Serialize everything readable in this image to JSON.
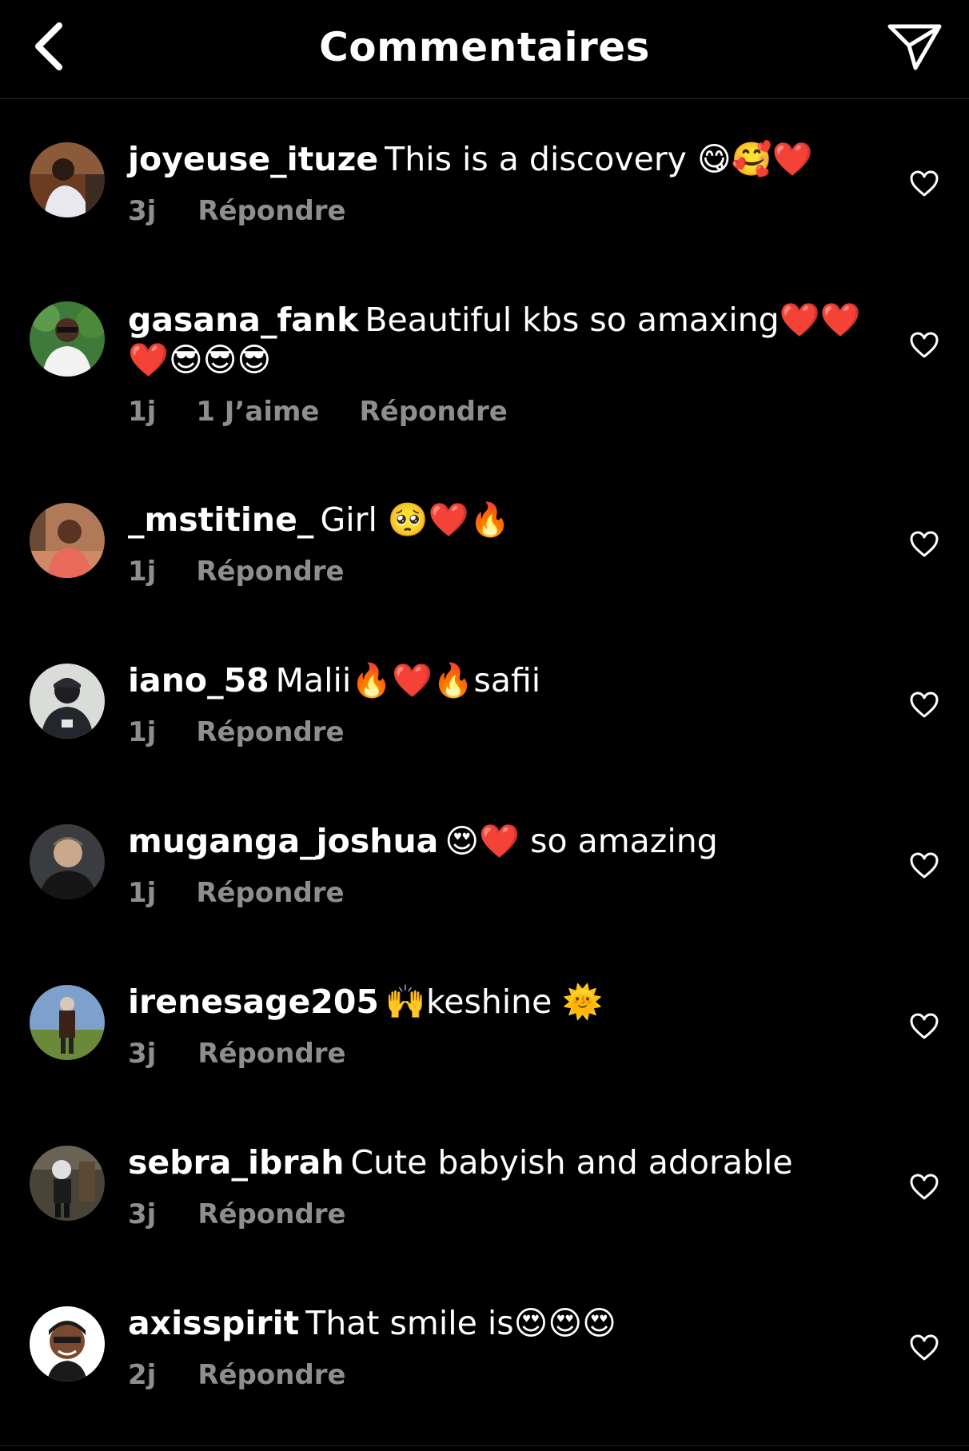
{
  "header": {
    "title": "Commentaires",
    "back_icon": "chevron-left-icon",
    "share_icon": "paper-plane-icon"
  },
  "comments": [
    {
      "username": "joyeuse_ituze",
      "text": "This is a discovery 😋🥰❤️",
      "age": "3j",
      "likes": "",
      "reply": "Répondre"
    },
    {
      "username": "gasana_fank",
      "text": "Beautiful kbs so amaxing❤️❤️❤️😎😎😎",
      "age": "1j",
      "likes": "1 J’aime",
      "reply": "Répondre"
    },
    {
      "username": "_mstitine_",
      "text": "Girl 🥺❤️🔥",
      "age": "1j",
      "likes": "",
      "reply": "Répondre"
    },
    {
      "username": "iano_58",
      "text": "Malii🔥❤️🔥safii",
      "age": "1j",
      "likes": "",
      "reply": "Répondre"
    },
    {
      "username": "muganga_joshua",
      "text": "😍❤️ so amazing",
      "age": "1j",
      "likes": "",
      "reply": "Répondre"
    },
    {
      "username": "irenesage205",
      "text": "🙌keshine 🌞",
      "age": "3j",
      "likes": "",
      "reply": "Répondre"
    },
    {
      "username": "sebra_ibrah",
      "text": "Cute babyish and adorable",
      "age": "3j",
      "likes": "",
      "reply": "Répondre"
    },
    {
      "username": "axisspirit",
      "text": "That smile is😍😍😍",
      "age": "2j",
      "likes": "",
      "reply": "Répondre"
    }
  ],
  "colors": {
    "background": "#000000",
    "text": "#ffffff",
    "secondary": "#8e8e8e",
    "divider": "#262626"
  }
}
